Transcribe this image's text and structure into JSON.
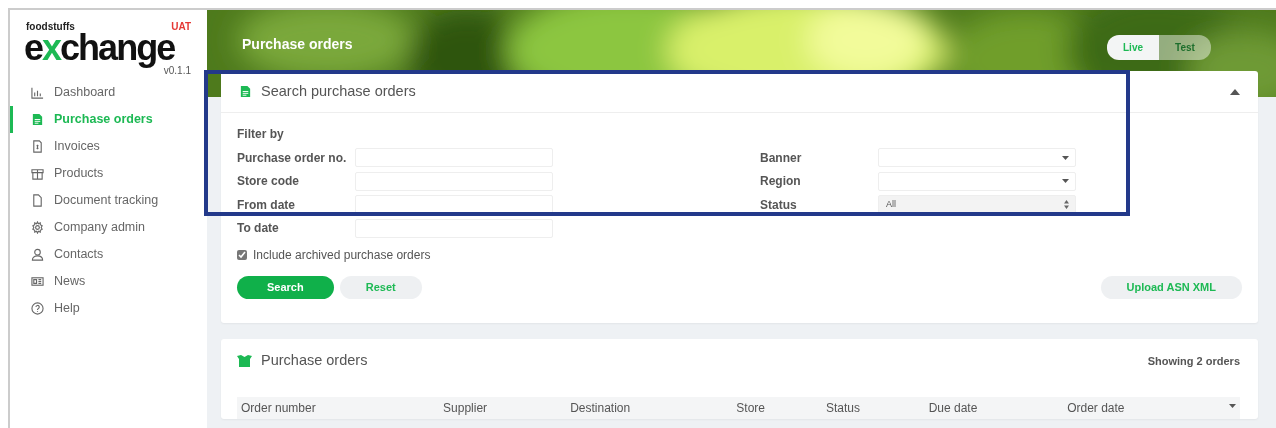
{
  "logo": {
    "brand_small": "foodstuffs",
    "brand": "exchange",
    "env": "UAT",
    "version": "v0.1.1"
  },
  "sidebar": {
    "items": [
      {
        "label": "Dashboard",
        "selected": false
      },
      {
        "label": "Purchase orders",
        "selected": true
      },
      {
        "label": "Invoices",
        "selected": false
      },
      {
        "label": "Products",
        "selected": false
      },
      {
        "label": "Document tracking",
        "selected": false
      },
      {
        "label": "Company admin",
        "selected": false
      },
      {
        "label": "Contacts",
        "selected": false
      },
      {
        "label": "News",
        "selected": false
      },
      {
        "label": "Help",
        "selected": false
      }
    ]
  },
  "header": {
    "title": "Purchase orders",
    "mode_toggle": [
      {
        "label": "Live",
        "selected": true
      },
      {
        "label": "Test",
        "selected": false
      }
    ]
  },
  "search_panel": {
    "title": "Search purchase orders",
    "expanded": true,
    "filter_heading": "Filter by",
    "left_fields": [
      {
        "label": "Purchase order no.",
        "kind": "text"
      },
      {
        "label": "Store code",
        "kind": "text"
      },
      {
        "label": "From date",
        "kind": "text"
      },
      {
        "label": "To date",
        "kind": "text"
      }
    ],
    "right_fields": [
      {
        "label": "Banner",
        "kind": "select"
      },
      {
        "label": "Region",
        "kind": "select"
      },
      {
        "label": "Status",
        "kind": "spinner",
        "value": "All"
      }
    ],
    "include_archived": {
      "label": "Include archived purchase orders",
      "checked": true
    },
    "buttons": [
      {
        "label": "Search",
        "kind": "primary"
      },
      {
        "label": "Reset",
        "kind": "secondary"
      },
      {
        "label": "Upload ASN XML",
        "kind": "upload"
      }
    ]
  },
  "orders_panel": {
    "title": "Purchase orders",
    "count": "Showing 2 orders",
    "table": {
      "columns": [
        "Order number",
        "Supplier",
        "Destination",
        "Store",
        "Status",
        "Due date",
        "Order date"
      ]
    }
  }
}
